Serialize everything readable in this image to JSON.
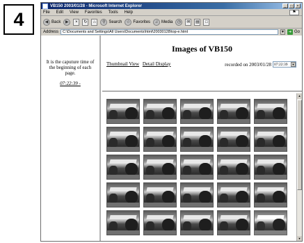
{
  "step_number": "4",
  "window": {
    "title": "VB150 2003/01/28 - Microsoft Internet Explorer",
    "buttons": [
      "_",
      "□",
      "×"
    ]
  },
  "menu": [
    "File",
    "Edit",
    "View",
    "Favorites",
    "Tools",
    "Help"
  ],
  "toolbar": {
    "back": "Back",
    "forward": "",
    "search": "Search",
    "favorites": "Favorites",
    "media": "Media"
  },
  "address": {
    "label": "Address",
    "value": "C:\\Documents and Settings\\All Users\\Documents\\html\\20030128\\top-e.html",
    "go": "Go"
  },
  "left_frame": {
    "note": "It is the caputure time of the beginning of each page.",
    "time_link": "07:22:39 -"
  },
  "top_frame": {
    "heading": "Images of VB150",
    "thumbnail_view": "Thumbnail View",
    "detail_display": "Detail Display",
    "recorded_label": "recorded on 2003/01/28",
    "time_select_value": "07:22:39"
  },
  "thumbnails": {
    "rows": 5,
    "cols": 5,
    "count": 25
  },
  "icons": [
    "ie-logo-icon",
    "back-icon",
    "forward-icon",
    "stop-icon",
    "refresh-icon",
    "home-icon",
    "search-icon",
    "favorites-icon",
    "media-icon",
    "history-icon",
    "mail-icon",
    "print-icon",
    "go-icon"
  ]
}
